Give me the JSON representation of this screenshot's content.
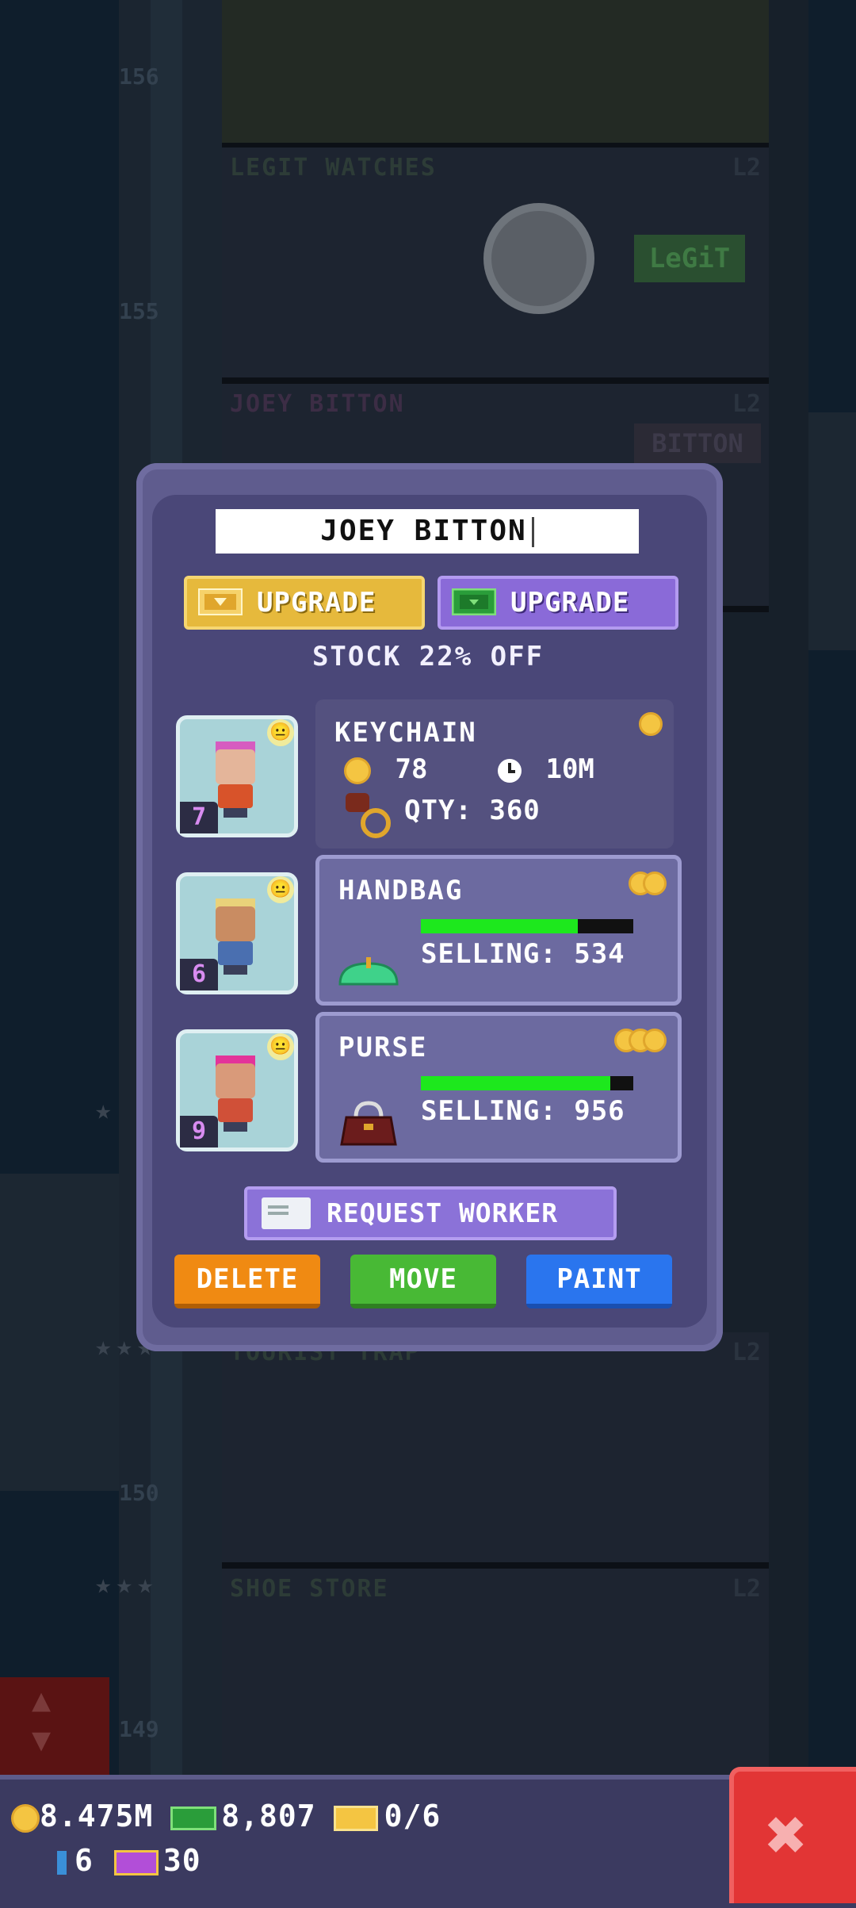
{
  "background": {
    "floors": [
      {
        "number": "156",
        "name": "",
        "level": ""
      },
      {
        "number": "155",
        "name": "LEGIT WATCHES",
        "level": "L2"
      },
      {
        "number": "",
        "name": "JOEY BITTON",
        "level": "L2"
      },
      {
        "number": "150",
        "name": "TOURIST TRAP",
        "level": "L2"
      },
      {
        "number": "149",
        "name": "SHOE STORE",
        "level": "L2"
      }
    ],
    "signs": {
      "legit": "LeGiT",
      "bitton": "BITTON"
    }
  },
  "dialog": {
    "name_value": "JOEY BITTON",
    "upgrade_gold_label": "UPGRADE",
    "upgrade_bux_label": "UPGRADE",
    "stock_text": "STOCK 22% OFF",
    "slots": [
      {
        "title": "KEYCHAIN",
        "cost": "78",
        "time": "10M",
        "qty": "QTY: 360",
        "tier": 1,
        "worker_level": "7"
      },
      {
        "title": "HANDBAG",
        "selling": "SELLING: 534",
        "progress": 0.74,
        "tier": 2,
        "worker_level": "6"
      },
      {
        "title": "PURSE",
        "selling": "SELLING: 956",
        "progress": 0.89,
        "tier": 3,
        "worker_level": "9"
      }
    ],
    "request_worker_label": "REQUEST WORKER",
    "delete_label": "DELETE",
    "move_label": "MOVE",
    "paint_label": "PAINT"
  },
  "hud": {
    "coins": "8.475M",
    "bux": "8,807",
    "tickets": "0/6",
    "elevator_count": "6",
    "vip_count": "30"
  },
  "colors": {
    "dialog": "#5f5c8e",
    "upgrade_gold": "#e6b93c",
    "upgrade_purple": "#8a6ad8",
    "delete": "#f08a12",
    "move": "#48b935",
    "paint": "#2a75ee",
    "close": "#e23535",
    "progress": "#1de81d"
  },
  "icons": {
    "coin": "coin-icon",
    "clock": "clock-icon",
    "bux": "bux-icon",
    "ticket": "golden-ticket-icon",
    "vip": "vip-ticket-icon",
    "close": "close-icon",
    "mood": "neutral-face-icon",
    "request": "envelope-icon"
  }
}
